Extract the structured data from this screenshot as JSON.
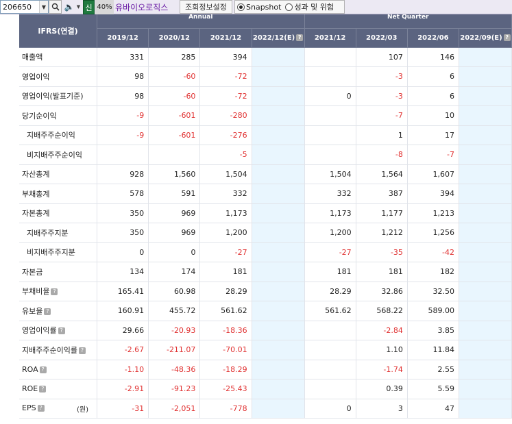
{
  "toolbar": {
    "stock_code": "206650",
    "dropdown_arrow": "▼",
    "search_icon": "search-icon",
    "speaker_icon": "🔈",
    "sin_label": "신",
    "percent_label": "40%",
    "company_name": "유바이오로직스",
    "settings_label": "조회정보설정",
    "view_options": [
      "Snapshot",
      "성과 및 위험"
    ],
    "view_selected": "Snapshot"
  },
  "table": {
    "corner_label": "IFRS(연결)",
    "group_annual": "Annual",
    "group_quarter": "Net Quarter",
    "periods": [
      "2019/12",
      "2020/12",
      "2021/12",
      "2022/12(E)",
      "2021/12",
      "2022/03",
      "2022/06",
      "2022/09(E)"
    ],
    "estimate_columns": [
      3,
      7
    ],
    "rows": [
      {
        "label": "매출액",
        "indent": false,
        "help": false,
        "unit": "",
        "values": [
          "331",
          "285",
          "394",
          "",
          "",
          "107",
          "146",
          ""
        ]
      },
      {
        "label": "영업이익",
        "indent": false,
        "help": false,
        "unit": "",
        "values": [
          "98",
          "-60",
          "-72",
          "",
          "",
          "-3",
          "6",
          ""
        ]
      },
      {
        "label": "영업이익(발표기준)",
        "indent": false,
        "help": false,
        "unit": "",
        "values": [
          "98",
          "-60",
          "-72",
          "",
          "0",
          "-3",
          "6",
          ""
        ]
      },
      {
        "label": "당기순이익",
        "indent": false,
        "help": false,
        "unit": "",
        "values": [
          "-9",
          "-601",
          "-280",
          "",
          "",
          "-7",
          "10",
          ""
        ]
      },
      {
        "label": "지배주주순이익",
        "indent": true,
        "help": false,
        "unit": "",
        "values": [
          "-9",
          "-601",
          "-276",
          "",
          "",
          "1",
          "17",
          ""
        ]
      },
      {
        "label": "비지배주주순이익",
        "indent": true,
        "help": false,
        "unit": "",
        "values": [
          "",
          "",
          "-5",
          "",
          "",
          "-8",
          "-7",
          ""
        ]
      },
      {
        "label": "자산총계",
        "indent": false,
        "help": false,
        "unit": "",
        "values": [
          "928",
          "1,560",
          "1,504",
          "",
          "1,504",
          "1,564",
          "1,607",
          ""
        ]
      },
      {
        "label": "부채총계",
        "indent": false,
        "help": false,
        "unit": "",
        "values": [
          "578",
          "591",
          "332",
          "",
          "332",
          "387",
          "394",
          ""
        ]
      },
      {
        "label": "자본총계",
        "indent": false,
        "help": false,
        "unit": "",
        "values": [
          "350",
          "969",
          "1,173",
          "",
          "1,173",
          "1,177",
          "1,213",
          ""
        ]
      },
      {
        "label": "지배주주지분",
        "indent": true,
        "help": false,
        "unit": "",
        "values": [
          "350",
          "969",
          "1,200",
          "",
          "1,200",
          "1,212",
          "1,256",
          ""
        ]
      },
      {
        "label": "비지배주주지분",
        "indent": true,
        "help": false,
        "unit": "",
        "values": [
          "0",
          "0",
          "-27",
          "",
          "-27",
          "-35",
          "-42",
          ""
        ]
      },
      {
        "label": "자본금",
        "indent": false,
        "help": false,
        "unit": "",
        "values": [
          "134",
          "174",
          "181",
          "",
          "181",
          "181",
          "182",
          ""
        ]
      },
      {
        "label": "부채비율",
        "indent": false,
        "help": true,
        "unit": "",
        "values": [
          "165.41",
          "60.98",
          "28.29",
          "",
          "28.29",
          "32.86",
          "32.50",
          ""
        ]
      },
      {
        "label": "유보율",
        "indent": false,
        "help": true,
        "unit": "",
        "values": [
          "160.91",
          "455.72",
          "561.62",
          "",
          "561.62",
          "568.22",
          "589.00",
          ""
        ]
      },
      {
        "label": "영업이익률",
        "indent": false,
        "help": true,
        "unit": "",
        "values": [
          "29.66",
          "-20.93",
          "-18.36",
          "",
          "",
          "-2.84",
          "3.85",
          ""
        ]
      },
      {
        "label": "지배주주순이익률",
        "indent": false,
        "help": true,
        "unit": "",
        "values": [
          "-2.67",
          "-211.07",
          "-70.01",
          "",
          "",
          "1.10",
          "11.84",
          ""
        ]
      },
      {
        "label": "ROA",
        "indent": false,
        "help": true,
        "unit": "",
        "values": [
          "-1.10",
          "-48.36",
          "-18.29",
          "",
          "",
          "-1.74",
          "2.55",
          ""
        ]
      },
      {
        "label": "ROE",
        "indent": false,
        "help": true,
        "unit": "",
        "values": [
          "-2.91",
          "-91.23",
          "-25.43",
          "",
          "",
          "0.39",
          "5.59",
          ""
        ]
      },
      {
        "label": "EPS",
        "indent": false,
        "help": true,
        "unit": "(원)",
        "values": [
          "-31",
          "-2,051",
          "-778",
          "",
          "0",
          "3",
          "47",
          ""
        ]
      }
    ]
  },
  "colors": {
    "header_bg": "#5b6480",
    "negative": "#e03030",
    "estimate_bg": "#e9f6fe",
    "company_name": "#6b1fa6",
    "badge_green": "#1f7a3f"
  }
}
